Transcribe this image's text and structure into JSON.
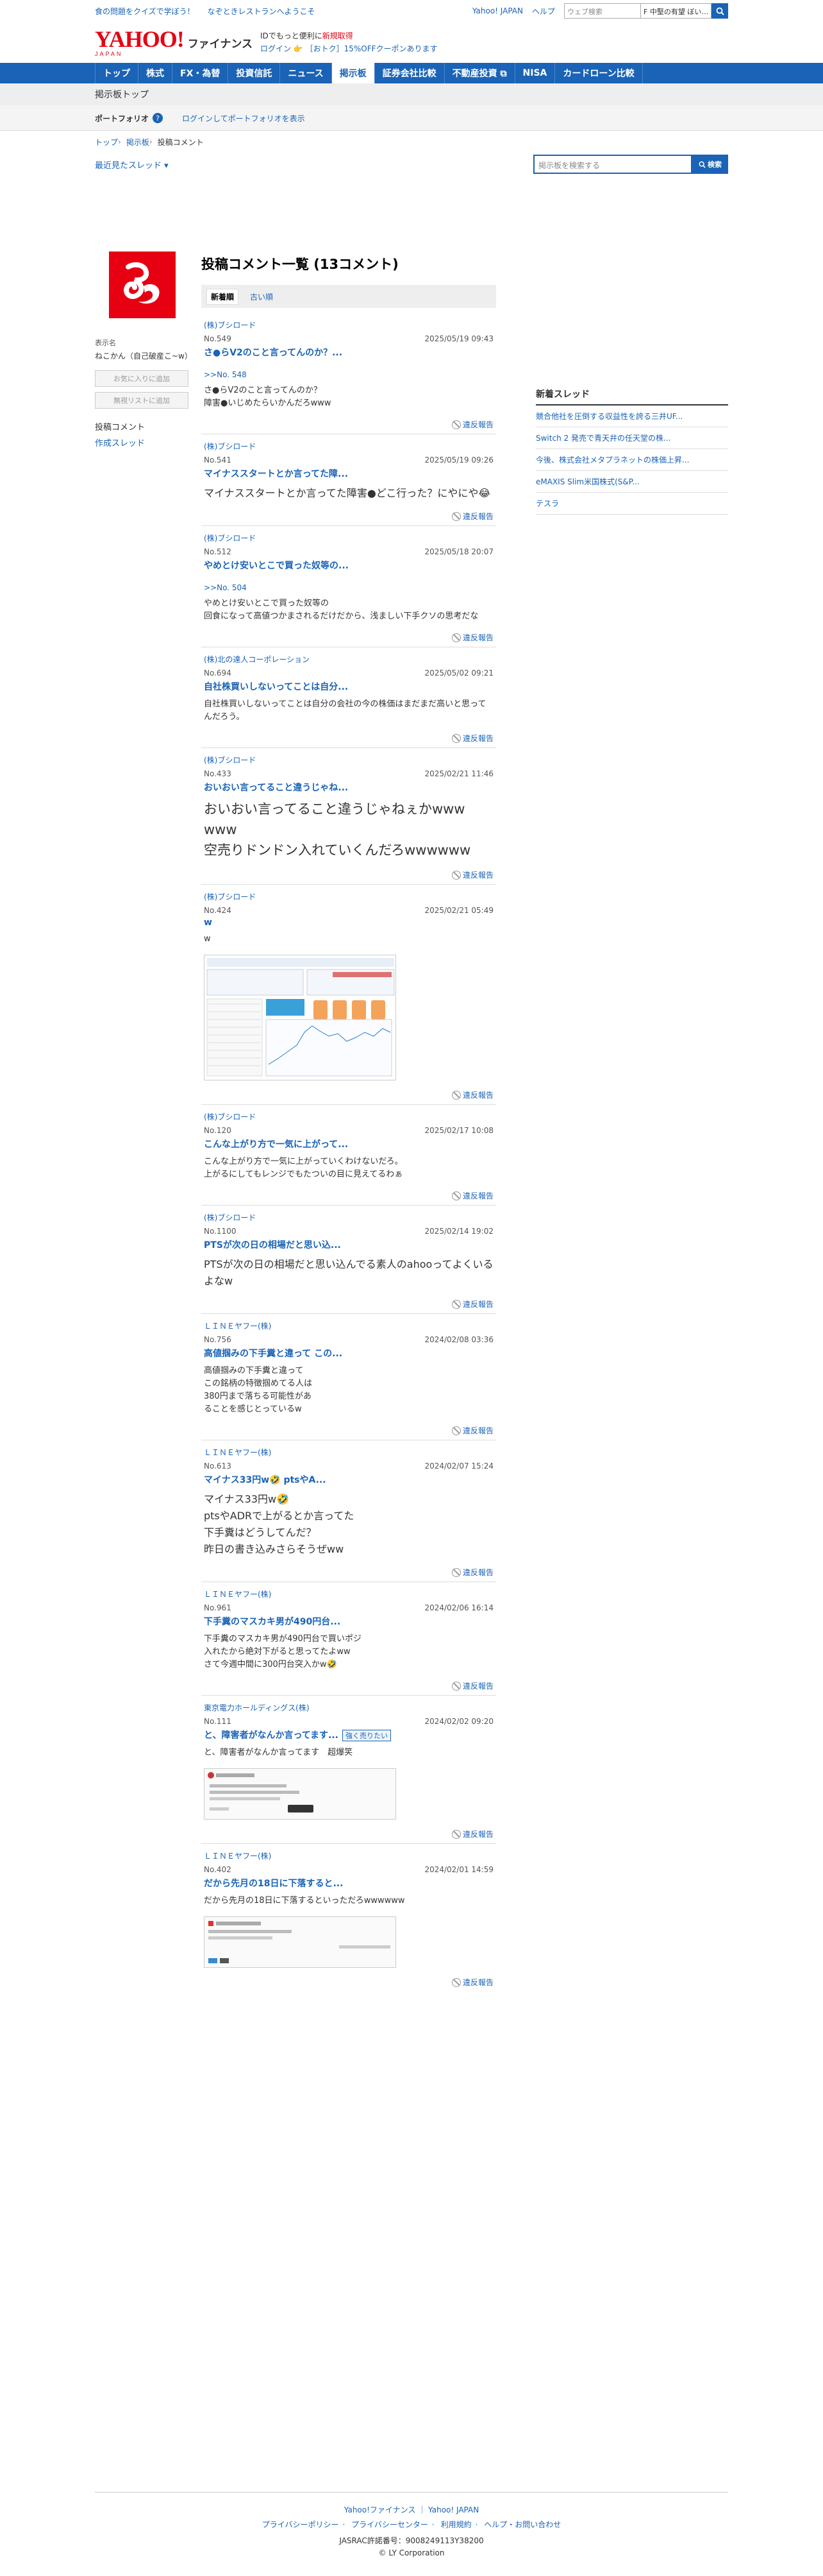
{
  "top": {
    "promo_1": "食の問題をクイズで学ぼう！",
    "promo_2": "なぞときレストランへようこそ",
    "link_yahoo": "Yahoo! JAPAN",
    "link_help": "ヘルプ",
    "web_search_placeholder": "ウェブ検索",
    "site_search_value": "F 中堅の有望 ぼい…"
  },
  "header": {
    "logo_text": "YAHOO!",
    "logo_sub": "JAPAN",
    "service": "ファイナンス",
    "id_line_prefix": "IDでもっと便利に",
    "id_line_link": "新規取得",
    "login": "ログイン",
    "coupon": "［おトク］15%OFFクーポンあります"
  },
  "nav": [
    "トップ",
    "株式",
    "FX・為替",
    "投資信託",
    "ニュース",
    "掲示板",
    "証券会社比較",
    "不動産投資 ⧉",
    "NISA",
    "カードローン比較"
  ],
  "subtitle": "掲示板トップ",
  "portfolio": {
    "label": "ポートフォリオ",
    "help": "?",
    "login_link": "ログインしてポートフォリオを表示"
  },
  "breadcrumb": [
    "トップ",
    "掲示板",
    "投稿コメント"
  ],
  "recent_threads": "最近見たスレッド ▾",
  "board_search": {
    "placeholder": "掲示板を検索する",
    "button": "検索"
  },
  "user": {
    "label": "表示名",
    "name": "ねこかん（自己破産こ~w）",
    "btn_favorite": "お気に入りに追加",
    "btn_ignore": "無視リストに追加",
    "nav_comments": "投稿コメント",
    "nav_threads": "作成スレッド"
  },
  "page_title": "投稿コメント一覧 (13コメント)",
  "sort": {
    "new": "新着順",
    "old": "古い順"
  },
  "report_label": "違反報告",
  "posts": [
    {
      "author": "(株)ブシロード",
      "no": "No.549",
      "date": "2025/05/19 09:43",
      "title": "さ●らV2のこと言ってんのか？...",
      "reply": ">>No. 548",
      "body": "さ●らV2のこと言ってんのか？\n障害●いじめたらいかんだろwww",
      "size": "s"
    },
    {
      "author": "(株)ブシロード",
      "no": "No.541",
      "date": "2025/05/19 09:26",
      "title": "マイナススタートとか言ってた障...",
      "reply": "",
      "body": "マイナススタートとか言ってた障害●どこ行った？にやにや😂",
      "size": "m"
    },
    {
      "author": "(株)ブシロード",
      "no": "No.512",
      "date": "2025/05/18 20:07",
      "title": "やめとけ安いとこで買った奴等の...",
      "reply": ">>No. 504",
      "body": "やめとけ安いとこで買った奴等の\n回食になって高値つかまされるだけだから、浅ましい下手クソの思考だな",
      "size": "s"
    },
    {
      "author": "(株)北の達人コーポレーション",
      "no": "No.694",
      "date": "2025/05/02 09:21",
      "title": "自社株買いしないってことは自分...",
      "reply": "",
      "body": "自社株買いしないってことは自分の会社の今の株価はまだまだ高いと思ってんだろう。",
      "size": "s"
    },
    {
      "author": "(株)ブシロード",
      "no": "No.433",
      "date": "2025/02/21 11:46",
      "title": "おいおい言ってること違うじゃね...",
      "reply": "",
      "body": "おいおい言ってること違うじゃねぇかwww\nwww\n空売りドンドン入れていくんだろwwwwww",
      "size": "l"
    },
    {
      "author": "(株)ブシロード",
      "no": "No.424",
      "date": "2025/02/21 05:49",
      "title": "w",
      "reply": "",
      "body": "w",
      "size": "s",
      "image": "chart"
    },
    {
      "author": "(株)ブシロード",
      "no": "No.120",
      "date": "2025/02/17 10:08",
      "title": "こんな上がり方で一気に上がって...",
      "reply": "",
      "body": "こんな上がり方で一気に上がっていくわけないだろ。\n上がるにしてもレンジでもたついの目に見えてるわぁ",
      "size": "s"
    },
    {
      "author": "(株)ブシロード",
      "no": "No.1100",
      "date": "2025/02/14 19:02",
      "title": "PTSが次の日の相場だと思い込...",
      "reply": "",
      "body": "PTSが次の日の相場だと思い込んでる素人のahooってよくいるよなw",
      "size": "m"
    },
    {
      "author": "ＬＩＮＥヤフー(株)",
      "no": "No.756",
      "date": "2024/02/08 03:36",
      "title": "高値掴みの下手糞と違って この...",
      "reply": "",
      "body": "高値掴みの下手糞と違って\nこの銘柄の特徴掴めてる人は\n380円まで落ちる可能性があ\nることを感じとっているw",
      "size": "s"
    },
    {
      "author": "ＬＩＮＥヤフー(株)",
      "no": "No.613",
      "date": "2024/02/07 15:24",
      "title": "マイナス33円w🤣 ptsやA...",
      "reply": "",
      "body": "マイナス33円w🤣\nptsやADRで上がるとか言ってた\n下手糞はどうしてんだ？\n昨日の書き込みさらそうぜww",
      "size": "m"
    },
    {
      "author": "ＬＩＮＥヤフー(株)",
      "no": "No.961",
      "date": "2024/02/06 16:14",
      "title": "下手糞のマスカキ男が490円台...",
      "reply": "",
      "body": "下手糞のマスカキ男が490円台で買いポジ\n入れたから絶対下がると思ってたよww\nさて今週中間に300円台突入かw🤣",
      "size": "s"
    },
    {
      "author": "東京電力ホールディングス(株)",
      "no": "No.111",
      "date": "2024/02/02 09:20",
      "title": "と、障害者がなんか言ってます...",
      "badge": "強く売りたい",
      "reply": "",
      "body": "と、障害者がなんか言ってます　超爆笑",
      "size": "s",
      "image": "shot1"
    },
    {
      "author": "ＬＩＮＥヤフー(株)",
      "no": "No.402",
      "date": "2024/02/01 14:59",
      "title": "だから先月の18日に下落すると...",
      "reply": "",
      "body": "だから先月の18日に下落するといっただろwwwwww",
      "size": "s",
      "image": "shot2"
    }
  ],
  "new_threads": {
    "title": "新着スレッド",
    "items": [
      "競合他社を圧倒する収益性を誇る三井UF...",
      "Switch 2 発売で青天井の任天堂の株...",
      "今後、株式会社メタプラネットの株価上昇...",
      "eMAXIS Slim米国株式(S&P...",
      "テスラ"
    ]
  },
  "footer": {
    "links1": "Yahoo!ファイナンス ｜ Yahoo! JAPAN",
    "links2": [
      "プライバシーポリシー",
      "プライバシーセンター",
      "利用規約",
      "ヘルプ・お問い合わせ"
    ],
    "jasrac": "JASRAC許諾番号：9008249113Y38200",
    "copyright": "© LY Corporation"
  },
  "colors": {
    "accent": "#1a63b6",
    "brand_red": "#e60012"
  }
}
